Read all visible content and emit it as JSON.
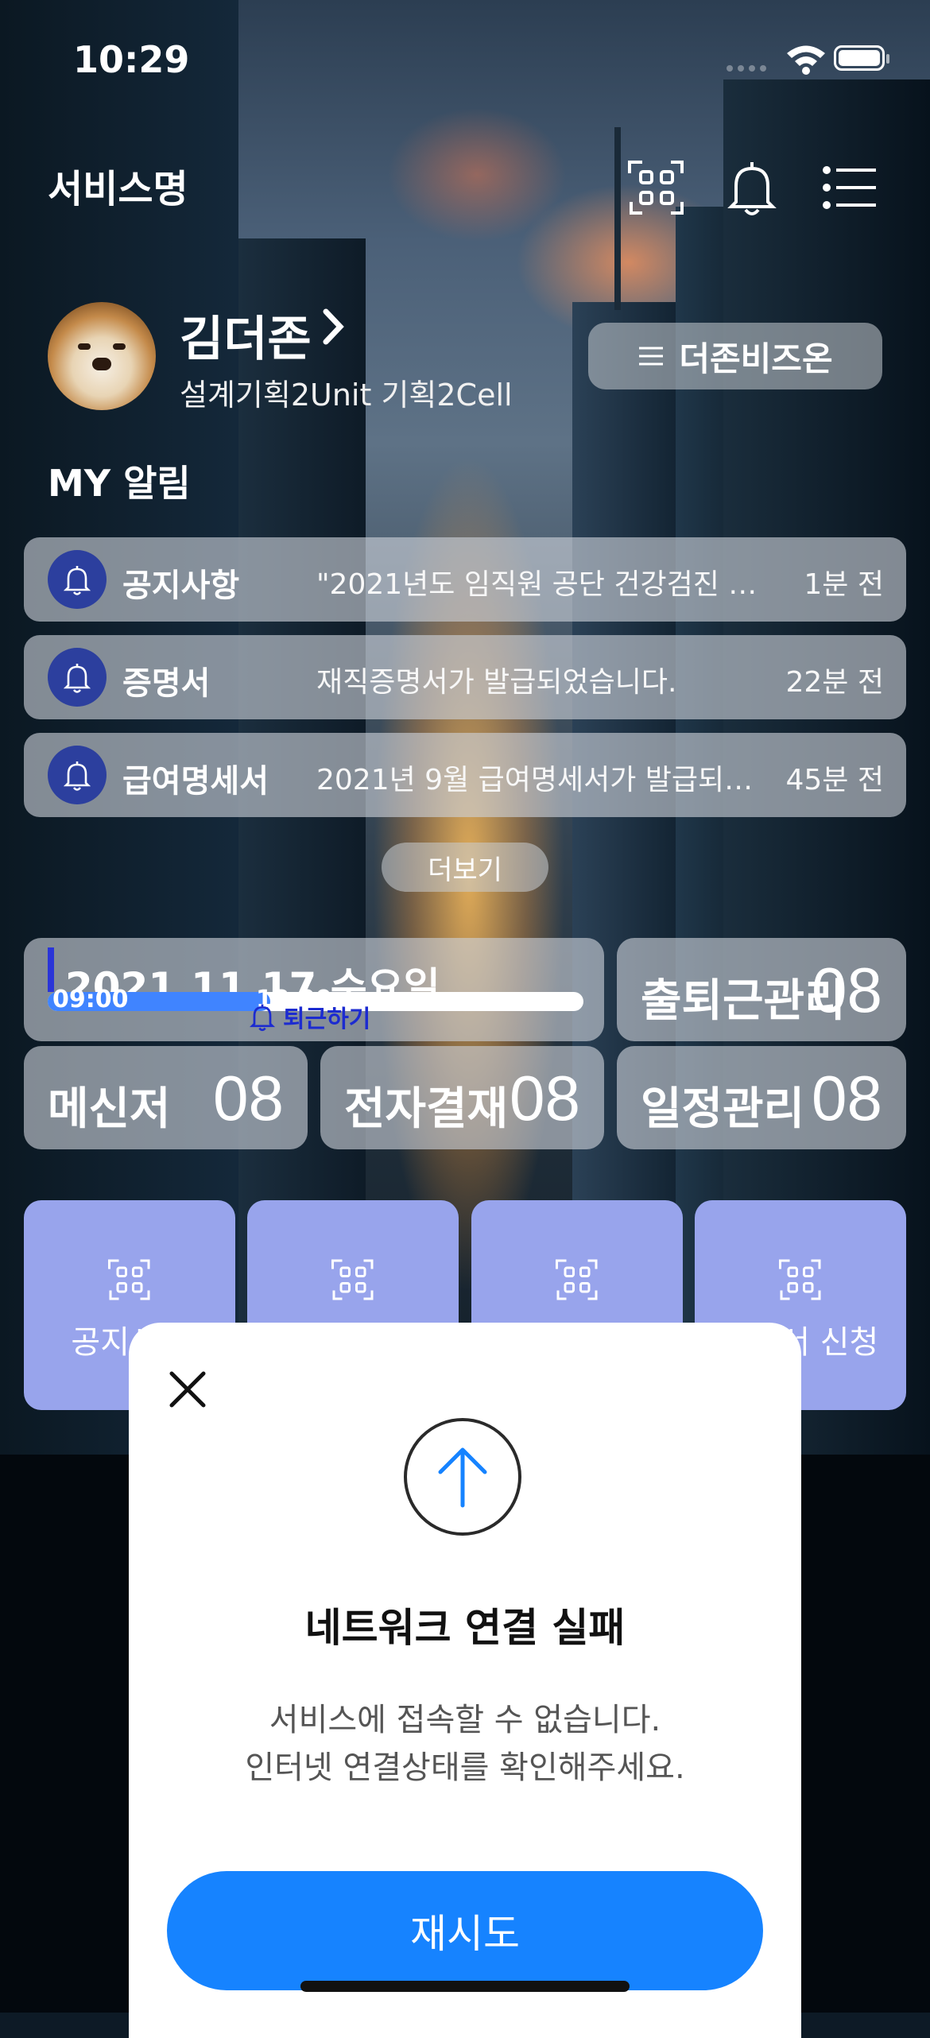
{
  "status_bar": {
    "time": "10:29"
  },
  "header": {
    "service_name": "서비스명",
    "icons": [
      "qr-scan-icon",
      "bell-icon",
      "menu-list-icon"
    ]
  },
  "profile": {
    "name": "김더존",
    "department": "설계기획2Unit 기획2Cell",
    "biz_button_label": "더존비즈온"
  },
  "alarms": {
    "title": "MY 알림",
    "items": [
      {
        "category": "공지사항",
        "message": "\"2021년도 임직원 공단 건강검진 실시...",
        "ago": "1분 전"
      },
      {
        "category": "증명서",
        "message": "재직증명서가 발급되었습니다.",
        "ago": "22분 전"
      },
      {
        "category": "급여명세서",
        "message": "2021년 9월 급여명세서가 발급되었습니...",
        "ago": "45분 전"
      }
    ],
    "more_label": "더보기"
  },
  "tiles": {
    "date_tile": {
      "date": "2021.11.17 수요일",
      "start_time": "09:00",
      "end_time": "18:00",
      "checkout_label": "퇴근하기"
    },
    "attendance": {
      "label": "출퇴근관리",
      "count": "08"
    },
    "messenger": {
      "label": "메신저",
      "count": "08"
    },
    "approval": {
      "label": "전자결재",
      "count": "08"
    },
    "schedule": {
      "label": "일정관리",
      "count": "08"
    }
  },
  "quick_menu": [
    {
      "label": "공지사항",
      "icon": "qr-scan-icon"
    },
    {
      "label": "",
      "icon": "qr-scan-icon"
    },
    {
      "label": "",
      "icon": "qr-scan-icon"
    },
    {
      "label": "증명서 신청",
      "icon": "qr-scan-icon"
    }
  ],
  "modal": {
    "title": "네트워크 연결 실패",
    "description": "서비스에 접속할 수 없습니다.\n인터넷 연결상태를 확인해주세요.",
    "retry_label": "재시도"
  },
  "colors": {
    "accent": "#1683FF",
    "quick_menu_bg": "#98A4EC",
    "bell_bg": "#2C3F9E"
  }
}
